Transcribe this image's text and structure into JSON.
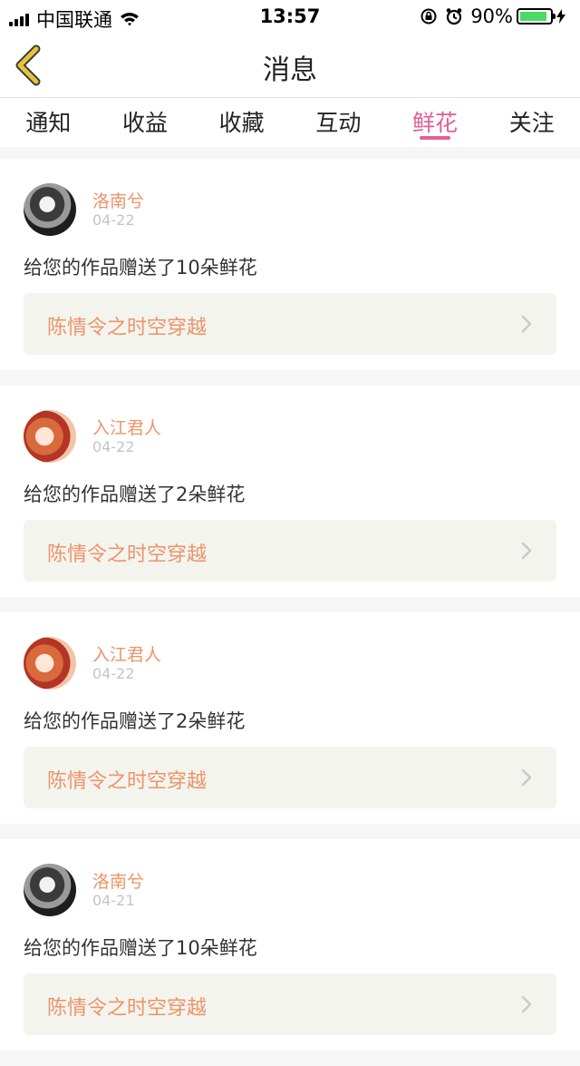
{
  "status_bar": {
    "carrier": "中国联通",
    "time": "13:57",
    "battery_percent": "90%",
    "battery_level": 0.9
  },
  "nav": {
    "title": "消息",
    "back_icon": "chevron-left-icon",
    "accent_color": "#e6c43a"
  },
  "tabs": [
    {
      "label": "通知",
      "active": false
    },
    {
      "label": "收益",
      "active": false
    },
    {
      "label": "收藏",
      "active": false
    },
    {
      "label": "互动",
      "active": false
    },
    {
      "label": "鲜花",
      "active": true
    },
    {
      "label": "关注",
      "active": false
    }
  ],
  "active_tab_color": "#e25f97",
  "messages": [
    {
      "user": "洛南兮",
      "date": "04-22",
      "text": "给您的作品赠送了10朵鲜花",
      "work": "陈情令之时空穿越"
    },
    {
      "user": "入江君人",
      "date": "04-22",
      "text": "给您的作品赠送了2朵鲜花",
      "work": "陈情令之时空穿越"
    },
    {
      "user": "入江君人",
      "date": "04-22",
      "text": "给您的作品赠送了2朵鲜花",
      "work": "陈情令之时空穿越"
    },
    {
      "user": "洛南兮",
      "date": "04-21",
      "text": "给您的作品赠送了10朵鲜花",
      "work": "陈情令之时空穿越"
    }
  ]
}
